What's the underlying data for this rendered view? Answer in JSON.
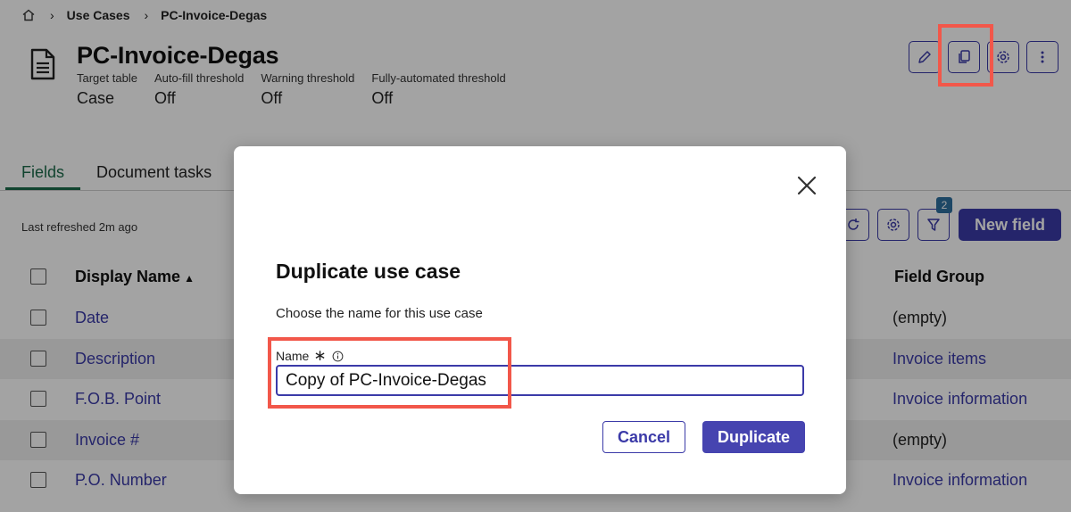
{
  "breadcrumb": {
    "items": [
      "Use Cases",
      "PC-Invoice-Degas"
    ]
  },
  "page": {
    "title": "PC-Invoice-Degas",
    "meta": [
      {
        "label": "Target table",
        "value": "Case"
      },
      {
        "label": "Auto-fill threshold",
        "value": "Off"
      },
      {
        "label": "Warning threshold",
        "value": "Off"
      },
      {
        "label": "Fully-automated threshold",
        "value": "Off"
      }
    ]
  },
  "tabs": [
    {
      "label": "Fields",
      "active": true
    },
    {
      "label": "Document tasks",
      "active": false
    }
  ],
  "list": {
    "last_refreshed": "Last refreshed 2m ago",
    "filter_count": "2",
    "new_field_label": "New field",
    "columns": {
      "display_name": "Display Name",
      "field_group": "Field Group"
    },
    "rows": [
      {
        "name": "Date",
        "group": "(empty)"
      },
      {
        "name": "Description",
        "group": "Invoice items"
      },
      {
        "name": "F.O.B. Point",
        "group": "Invoice information"
      },
      {
        "name": "Invoice #",
        "group": "(empty)"
      },
      {
        "name": "P.O. Number",
        "group": "Invoice information"
      }
    ]
  },
  "modal": {
    "title": "Duplicate use case",
    "description": "Choose the name for this use case",
    "field_label": "Name",
    "name_value": "Copy of PC-Invoice-Degas",
    "cancel_label": "Cancel",
    "duplicate_label": "Duplicate"
  },
  "colors": {
    "accent": "#3b3aa8",
    "highlight": "#f2574a",
    "active_tab": "#1c6b4a"
  }
}
